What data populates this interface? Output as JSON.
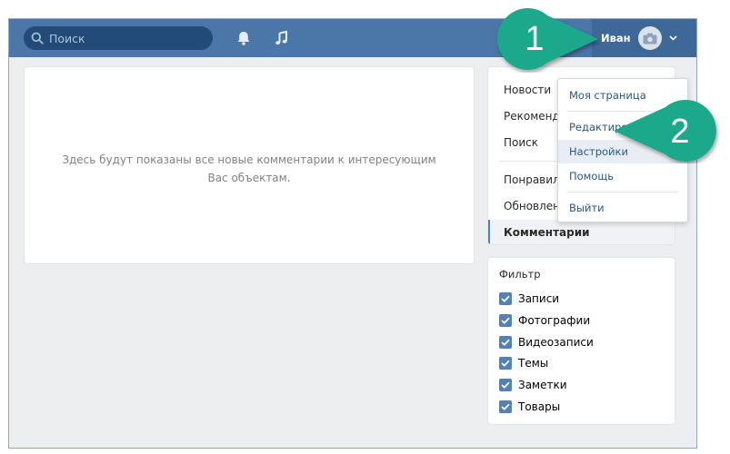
{
  "header": {
    "search_placeholder": "Поиск",
    "user_name": "Иван",
    "colors": {
      "header_bg": "#4a76a8",
      "search_bg": "#224b7a",
      "user_bg": "#3d6898"
    }
  },
  "main": {
    "empty_message": "Здесь будут показаны все новые комментарии к интересующим Вас объектам."
  },
  "nav": {
    "items": [
      {
        "label": "Новости"
      },
      {
        "label": "Рекомендации"
      },
      {
        "label": "Поиск"
      },
      {
        "label": "Понравилось"
      },
      {
        "label": "Обновления"
      },
      {
        "label": "Комментарии",
        "active": true
      }
    ]
  },
  "filter": {
    "title": "Фильтр",
    "options": [
      {
        "label": "Записи",
        "checked": true
      },
      {
        "label": "Фотографии",
        "checked": true
      },
      {
        "label": "Видеозаписи",
        "checked": true
      },
      {
        "label": "Темы",
        "checked": true
      },
      {
        "label": "Заметки",
        "checked": true
      },
      {
        "label": "Товары",
        "checked": true
      }
    ]
  },
  "dropdown": {
    "items": [
      {
        "label": "Моя страница"
      },
      {
        "label": "Редактировать"
      },
      {
        "label": "Настройки",
        "highlighted": true
      },
      {
        "label": "Помощь"
      },
      {
        "label": "Выйти"
      }
    ]
  },
  "callouts": {
    "first": "1",
    "second": "2",
    "color": "#1fa88a"
  }
}
